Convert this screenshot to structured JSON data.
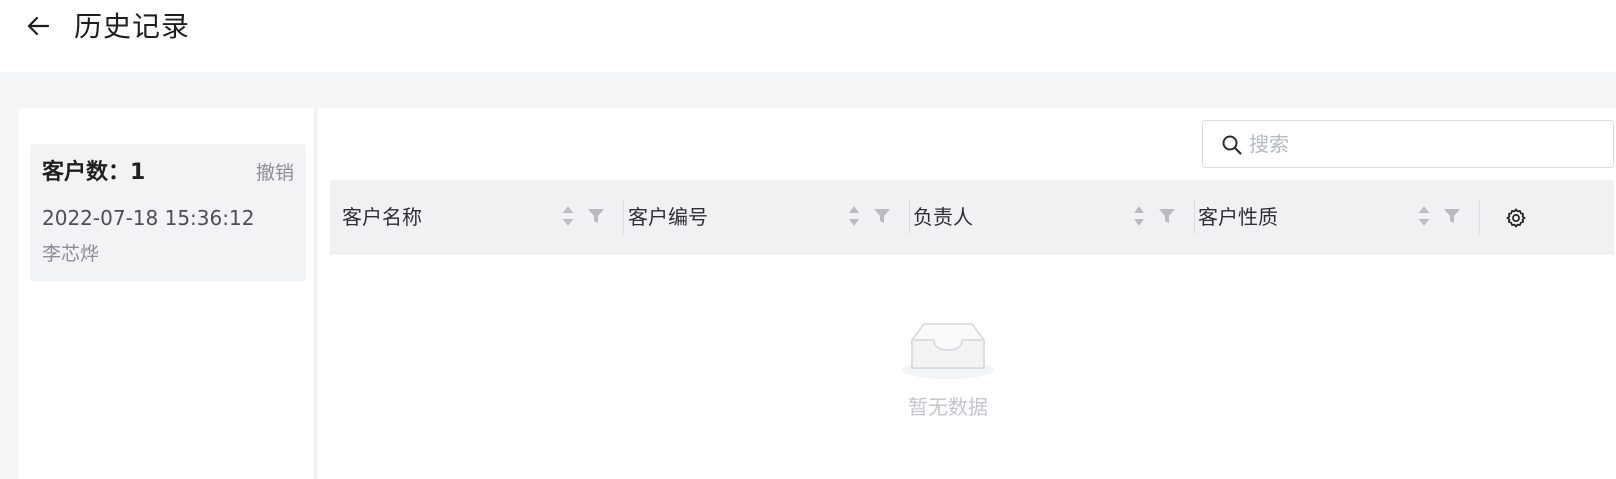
{
  "header": {
    "title": "历史记录",
    "back_icon": "arrow-left-icon"
  },
  "history": {
    "records": [
      {
        "count_label": "客户数：1",
        "undo_label": "撤销",
        "timestamp": "2022-07-18 15:36:12",
        "operator": "李芯烨"
      }
    ]
  },
  "search": {
    "placeholder": "搜索",
    "value": "",
    "icon": "search-icon"
  },
  "table": {
    "columns": [
      {
        "label": "客户名称"
      },
      {
        "label": "客户编号"
      },
      {
        "label": "负责人"
      },
      {
        "label": "客户性质"
      }
    ],
    "settings_icon": "gear-icon",
    "rows": [],
    "empty_text": "暂无数据"
  },
  "colors": {
    "page_bg": "#f5f6f7",
    "card_bg": "#f2f3f5",
    "header_row_bg": "#f0f1f3",
    "muted_text": "#8a8f97",
    "empty_text": "#c3c6cc"
  }
}
